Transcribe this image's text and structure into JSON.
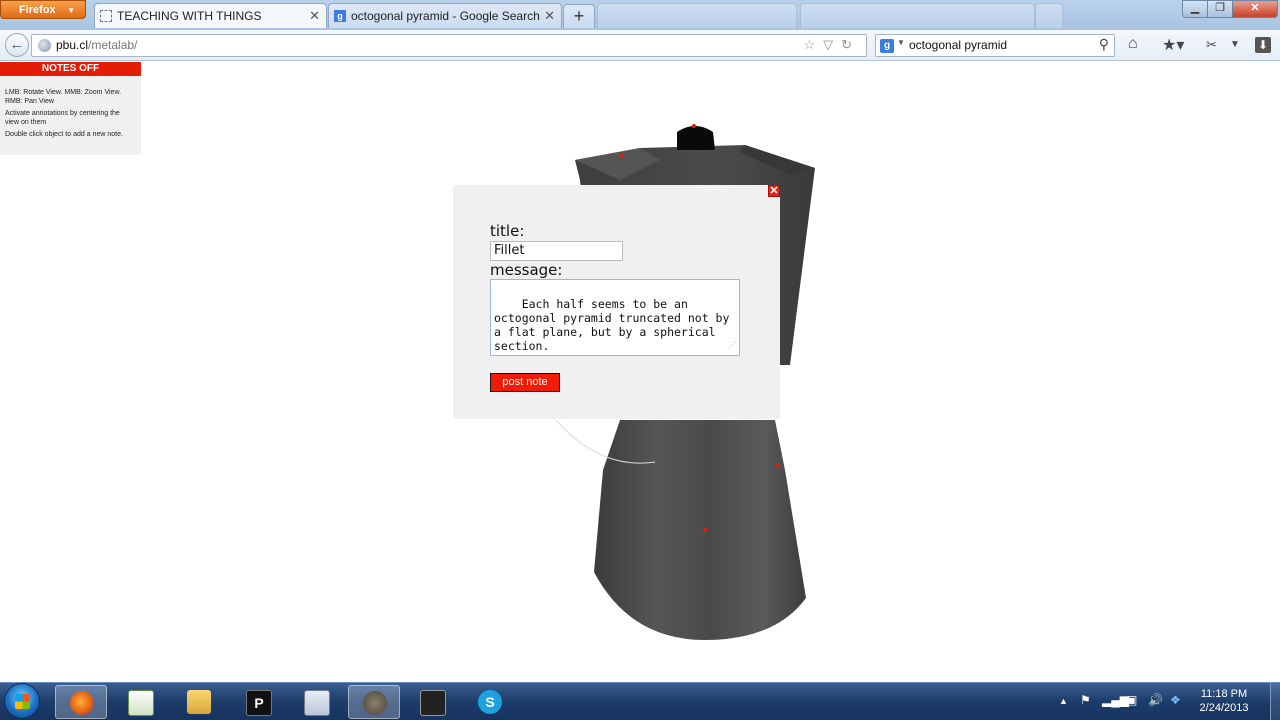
{
  "browser": {
    "menu_button": "Firefox",
    "tabs": [
      {
        "label": "TEACHING WITH THINGS",
        "active": true
      },
      {
        "label": "octogonal pyramid - Google Search",
        "active": false
      }
    ],
    "url_host": "pbu.cl",
    "url_path": "/metalab/",
    "search_query": "octogonal pyramid",
    "search_engine_icon": "g-icon"
  },
  "notes_panel": {
    "toggle_label": "NOTES OFF",
    "help": [
      "LMB: Rotate View. MMB: Zoom View. RMB: Pan View",
      "Activate annotations by centering the view on them",
      "Double click object to add a new note."
    ]
  },
  "note_form": {
    "title_label": "title:",
    "title_value": "Fillet",
    "message_label": "message:",
    "message_value": "Each half seems to be an octogonal pyramid truncated not by a flat plane, but by a spherical section.",
    "submit_label": "post note",
    "close_symbol": "✕"
  },
  "taskbar": {
    "apps": [
      "firefox",
      "notepad",
      "file-explorer",
      "p-app",
      "calculator",
      "gimp",
      "rhino",
      "skype"
    ],
    "clock_time": "11:18 PM",
    "clock_date": "2/24/2013"
  },
  "colors": {
    "accent_red": "#e51d07",
    "model_gray": "#4a4a4a",
    "modal_bg": "#f0f0f0"
  }
}
